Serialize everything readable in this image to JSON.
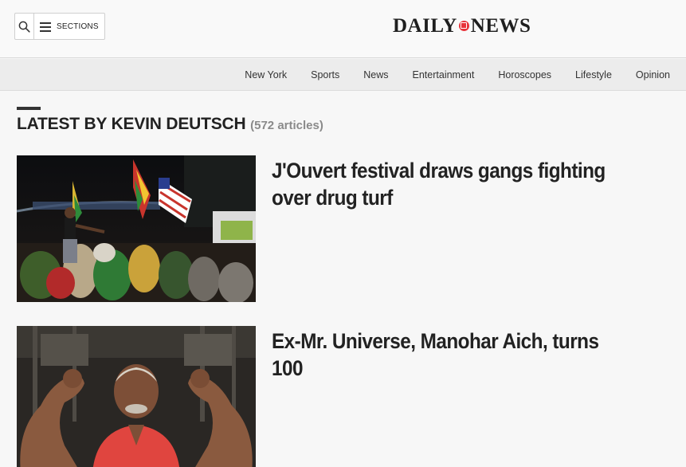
{
  "header": {
    "sections_label": "SECTIONS",
    "logo_left": "DAILY",
    "logo_right": "NEWS"
  },
  "nav": {
    "items": [
      "New York",
      "Sports",
      "News",
      "Entertainment",
      "Horoscopes",
      "Lifestyle",
      "Opinion"
    ]
  },
  "author": {
    "heading": "LATEST BY KEVIN DEUTSCH",
    "count": "(572 articles)"
  },
  "articles": [
    {
      "headline": "J'Ouvert festival draws gangs fighting over drug turf",
      "image": "jouvert-festival-photo"
    },
    {
      "headline": "Ex-Mr. Universe, Manohar Aich, turns 100",
      "image": "manohar-aich-photo"
    }
  ],
  "colors": {
    "logo_accent": "#e8333a",
    "text": "#222222",
    "muted": "#8a8a8a"
  }
}
